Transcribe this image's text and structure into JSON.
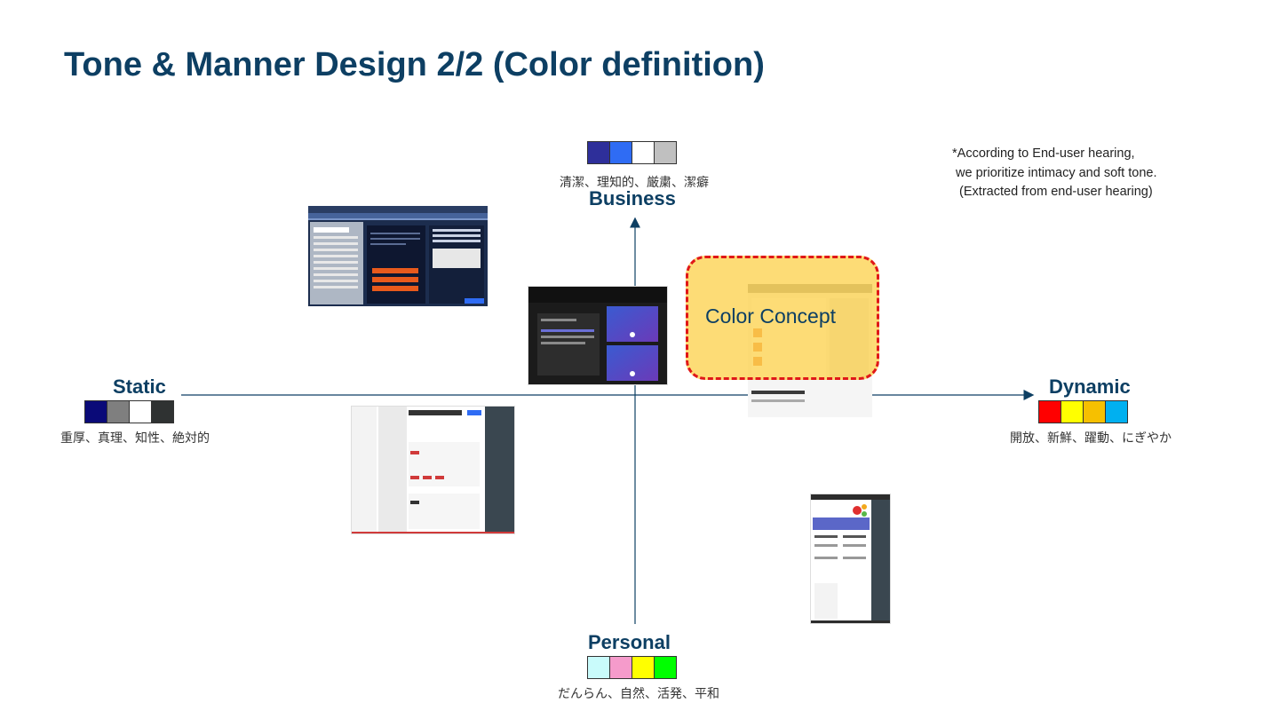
{
  "title": "Tone & Manner Design 2/2 (Color definition)",
  "note": "*According to End-user hearing,\n we prioritize intimacy and soft tone.\n  (Extracted from end-user hearing)",
  "axes": {
    "top": {
      "label": "Business",
      "desc": "清潔、理知的、厳粛、潔癖",
      "colors": [
        "#2e2f9a",
        "#2f6cf4",
        "#ffffff",
        "#c0c0c0"
      ]
    },
    "bottom": {
      "label": "Personal",
      "desc": "だんらん、自然、活発、平和",
      "colors": [
        "#c9fbfb",
        "#f59bcb",
        "#ffff00",
        "#00ff00"
      ]
    },
    "left": {
      "label": "Static",
      "desc": "重厚、真理、知性、絶対的",
      "colors": [
        "#0a0a78",
        "#7f7f7f",
        "#ffffff",
        "#2f3232"
      ]
    },
    "right": {
      "label": "Dynamic",
      "desc": "開放、新鮮、躍動、にぎやか",
      "colors": [
        "#ff0000",
        "#ffff00",
        "#f6c000",
        "#00b0f0"
      ]
    }
  },
  "concept": {
    "label": "Color Concept"
  }
}
